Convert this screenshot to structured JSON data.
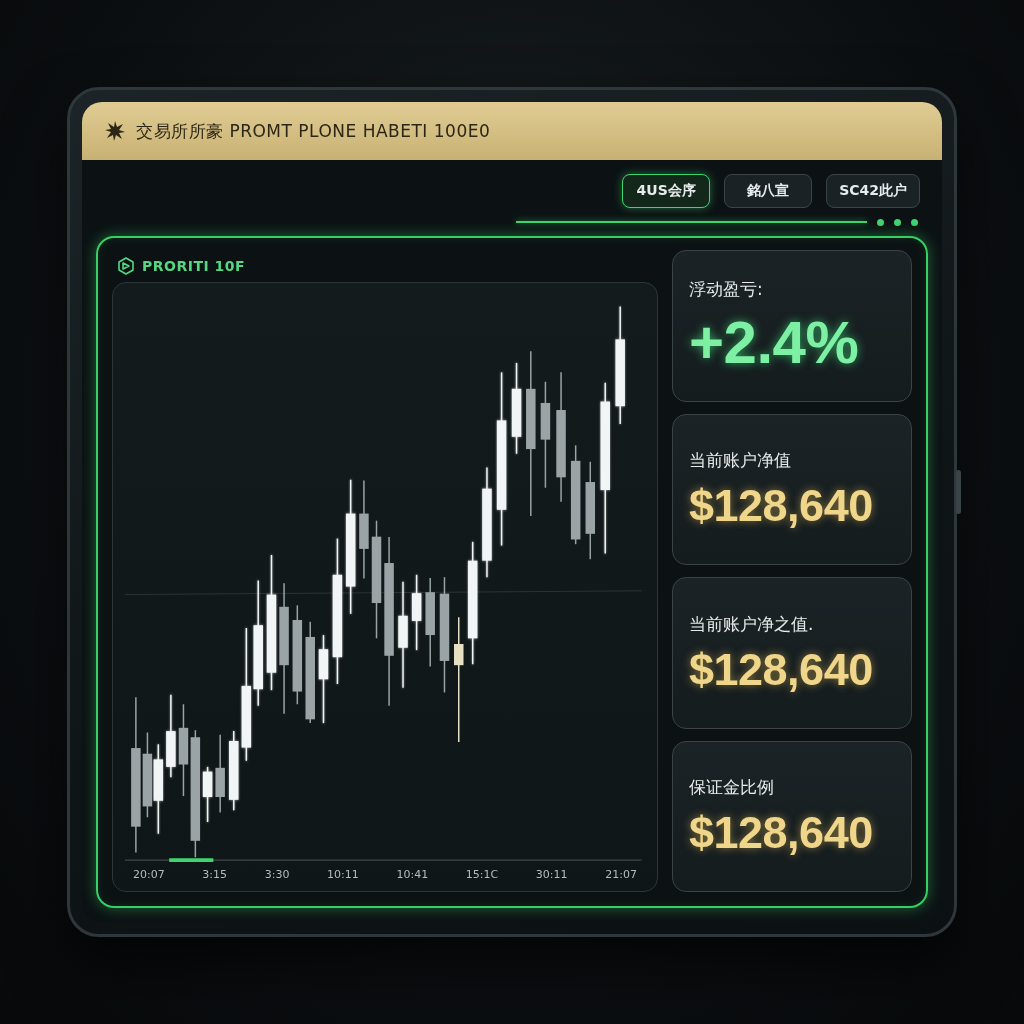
{
  "header": {
    "title": "交易所所豪 PROMT PLONE HABETI 100E0"
  },
  "nav": {
    "buttons": [
      {
        "label": "4US会序",
        "selected": true
      },
      {
        "label": "銘八宣",
        "selected": false
      },
      {
        "label": "SC42此户",
        "selected": false
      }
    ]
  },
  "chart_panel": {
    "title": "PRORITI 10F",
    "x_labels": [
      "20:07",
      "3:15",
      "3:30",
      "10:11",
      "10:41",
      "15:1C",
      "30:11",
      "21:07"
    ]
  },
  "stats": [
    {
      "label": "浮动盈亏:",
      "value": "+2.4%",
      "kind": "percent"
    },
    {
      "label": "当前账户净值",
      "value": "$128,640",
      "kind": "amount"
    },
    {
      "label": "当前账户净之值.",
      "value": "$128,640",
      "kind": "amount"
    },
    {
      "label": "保证金比例",
      "value": "$128,640",
      "kind": "amount"
    }
  ]
}
